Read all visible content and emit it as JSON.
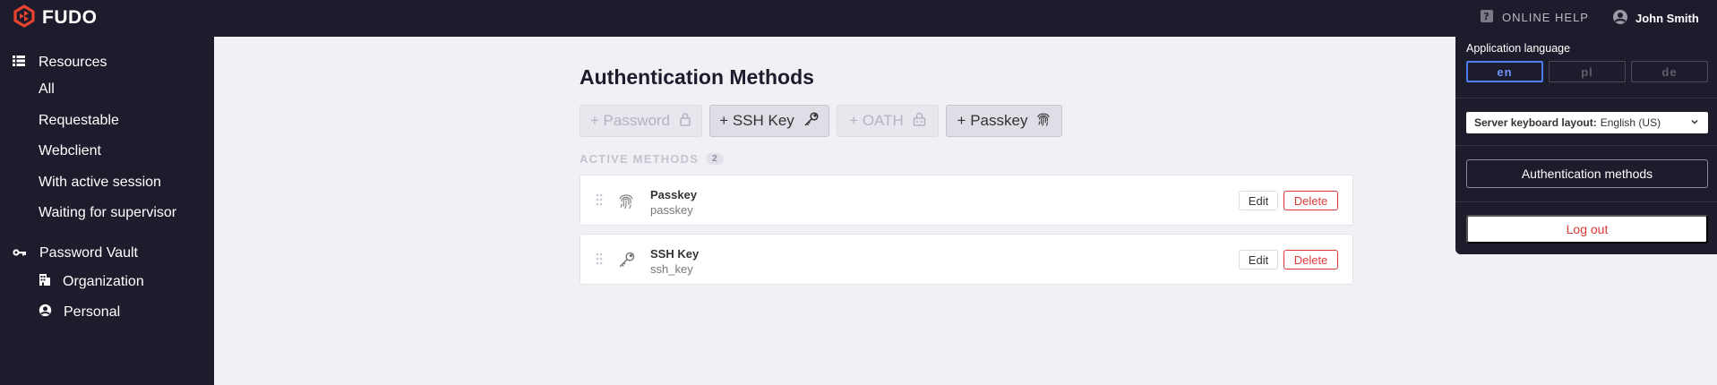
{
  "brand": {
    "name": "FUDO",
    "accent": "#e8432e"
  },
  "header": {
    "help_label": "ONLINE HELP",
    "help_icon": "question-icon",
    "user_name": "John Smith",
    "user_icon": "user-circle-icon"
  },
  "sidebar": {
    "resources": {
      "label": "Resources",
      "icon": "list-icon",
      "items": [
        "All",
        "Requestable",
        "Webclient",
        "With active session",
        "Waiting for supervisor"
      ]
    },
    "vault": {
      "label": "Password Vault",
      "icon": "key-icon",
      "items": [
        {
          "label": "Organization",
          "icon": "building-icon"
        },
        {
          "label": "Personal",
          "icon": "user-circle-icon"
        }
      ]
    }
  },
  "main": {
    "title": "Authentication Methods",
    "add_buttons": [
      {
        "label": "+ Password",
        "icon": "lock-icon",
        "enabled": false
      },
      {
        "label": "+ SSH Key",
        "icon": "key-icon",
        "enabled": true
      },
      {
        "label": "+ OATH",
        "icon": "lock-icon",
        "enabled": false
      },
      {
        "label": "+ Passkey",
        "icon": "fingerprint-icon",
        "enabled": true
      }
    ],
    "active_label": "ACTIVE METHODS",
    "active_count": "2",
    "methods": [
      {
        "name": "Passkey",
        "type": "passkey",
        "icon": "fingerprint-icon",
        "edit": "Edit",
        "delete": "Delete"
      },
      {
        "name": "SSH Key",
        "type": "ssh_key",
        "icon": "key-icon",
        "edit": "Edit",
        "delete": "Delete"
      }
    ]
  },
  "dropdown": {
    "language_label": "Application language",
    "languages": [
      {
        "code": "en",
        "active": true
      },
      {
        "code": "pl",
        "active": false
      },
      {
        "code": "de",
        "active": false
      }
    ],
    "keyboard_label": "Server keyboard layout:",
    "keyboard_value": "English (US)",
    "auth_methods_label": "Authentication methods",
    "logout_label": "Log out",
    "logout_color": "#e03737",
    "lang_active_color": "#4d7ef0"
  }
}
